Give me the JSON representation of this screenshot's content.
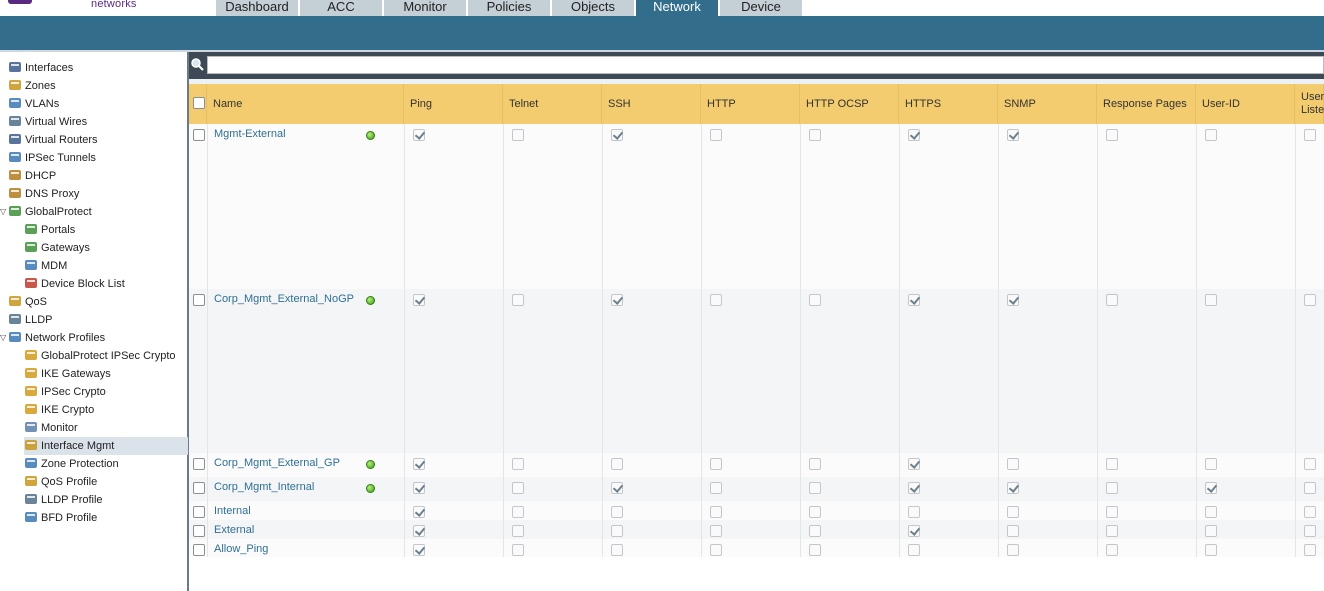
{
  "brand": {
    "name": "networks",
    "accent": "#5a2a82",
    "band_color": "#336d8c"
  },
  "tabs": [
    {
      "label": "Dashboard",
      "active": false
    },
    {
      "label": "ACC",
      "active": false
    },
    {
      "label": "Monitor",
      "active": false
    },
    {
      "label": "Policies",
      "active": false
    },
    {
      "label": "Objects",
      "active": false
    },
    {
      "label": "Network",
      "active": true
    },
    {
      "label": "Device",
      "active": false
    }
  ],
  "sidebar": {
    "items": [
      {
        "label": "Interfaces",
        "icon": "interfaces-icon"
      },
      {
        "label": "Zones",
        "icon": "zones-icon"
      },
      {
        "label": "VLANs",
        "icon": "vlans-icon"
      },
      {
        "label": "Virtual Wires",
        "icon": "virtual-wires-icon"
      },
      {
        "label": "Virtual Routers",
        "icon": "virtual-routers-icon"
      },
      {
        "label": "IPSec Tunnels",
        "icon": "ipsec-tunnels-icon"
      },
      {
        "label": "DHCP",
        "icon": "dhcp-icon"
      },
      {
        "label": "DNS Proxy",
        "icon": "dns-proxy-icon"
      },
      {
        "label": "GlobalProtect",
        "icon": "globalprotect-icon",
        "expanded": true
      },
      {
        "label": "Portals",
        "icon": "portals-icon"
      },
      {
        "label": "Gateways",
        "icon": "gateways-icon"
      },
      {
        "label": "MDM",
        "icon": "mdm-icon"
      },
      {
        "label": "Device Block List",
        "icon": "device-block-list-icon"
      },
      {
        "label": "QoS",
        "icon": "qos-icon"
      },
      {
        "label": "LLDP",
        "icon": "lldp-icon"
      },
      {
        "label": "Network Profiles",
        "icon": "network-profiles-icon",
        "expanded": true
      },
      {
        "label": "GlobalProtect IPSec Crypto",
        "icon": "lock-icon"
      },
      {
        "label": "IKE Gateways",
        "icon": "ike-gateways-icon"
      },
      {
        "label": "IPSec Crypto",
        "icon": "lock-icon"
      },
      {
        "label": "IKE Crypto",
        "icon": "lock-icon"
      },
      {
        "label": "Monitor",
        "icon": "monitor-icon"
      },
      {
        "label": "Interface Mgmt",
        "icon": "interface-mgmt-icon",
        "selected": true
      },
      {
        "label": "Zone Protection",
        "icon": "zone-protection-icon"
      },
      {
        "label": "QoS Profile",
        "icon": "qos-profile-icon"
      },
      {
        "label": "LLDP Profile",
        "icon": "lldp-profile-icon"
      },
      {
        "label": "BFD Profile",
        "icon": "bfd-profile-icon"
      }
    ]
  },
  "search": {
    "placeholder": "",
    "value": ""
  },
  "table": {
    "columns": [
      "Name",
      "Ping",
      "Telnet",
      "SSH",
      "HTTP",
      "HTTP OCSP",
      "HTTPS",
      "SNMP",
      "Response Pages",
      "User-ID",
      "User-ID Syslog Listener"
    ],
    "last_column_visible_lines": [
      "User",
      "Liste"
    ],
    "rows": [
      {
        "name": "Mgmt-External",
        "in_use": true,
        "checks": [
          true,
          false,
          true,
          false,
          false,
          true,
          true,
          false,
          false,
          false
        ]
      },
      {
        "name": "Corp_Mgmt_External_NoGP",
        "in_use": true,
        "checks": [
          true,
          false,
          true,
          false,
          false,
          true,
          true,
          false,
          false,
          false
        ]
      },
      {
        "name": "Corp_Mgmt_External_GP",
        "in_use": true,
        "checks": [
          true,
          false,
          false,
          false,
          false,
          true,
          false,
          false,
          false,
          false
        ]
      },
      {
        "name": "Corp_Mgmt_Internal",
        "in_use": true,
        "checks": [
          true,
          false,
          true,
          false,
          false,
          true,
          true,
          false,
          true,
          false
        ]
      },
      {
        "name": "Internal",
        "in_use": false,
        "checks": [
          true,
          false,
          false,
          false,
          false,
          false,
          false,
          false,
          false,
          false
        ]
      },
      {
        "name": "External",
        "in_use": false,
        "checks": [
          true,
          false,
          false,
          false,
          false,
          true,
          false,
          false,
          false,
          false
        ]
      },
      {
        "name": "Allow_Ping",
        "in_use": false,
        "checks": [
          true,
          false,
          false,
          false,
          false,
          false,
          false,
          false,
          false,
          false
        ]
      }
    ]
  }
}
